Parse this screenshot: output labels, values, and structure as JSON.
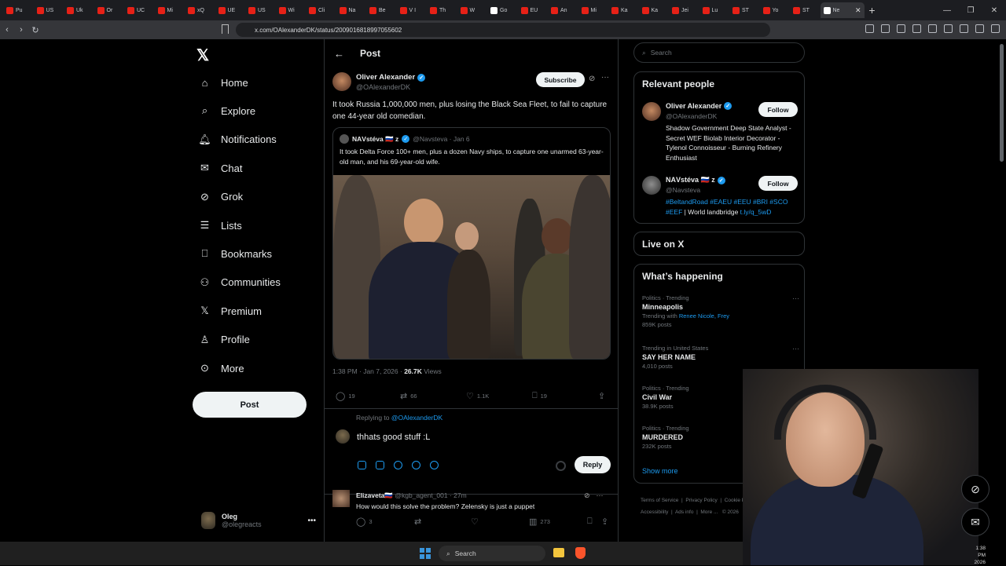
{
  "browser": {
    "tabs": [
      "Pu",
      "US",
      "Uk",
      "Or",
      "UC",
      "Mi",
      "xQ",
      "UE",
      "US",
      "Wi",
      "Cli",
      "Na",
      "Be",
      "V I",
      "Th",
      "W",
      "Go",
      "EU",
      "An",
      "Mi",
      "Ka",
      "Ka",
      "Jei",
      "Lu",
      "ST",
      "Yo",
      "ST",
      "Ne"
    ],
    "url": "x.com/OAlexanderDK/status/2009016818997055602",
    "new_tab": "+"
  },
  "nav": {
    "items": [
      {
        "label": "Home",
        "icon": "home-icon"
      },
      {
        "label": "Explore",
        "icon": "search-icon"
      },
      {
        "label": "Notifications",
        "icon": "bell-icon"
      },
      {
        "label": "Chat",
        "icon": "mail-icon"
      },
      {
        "label": "Grok",
        "icon": "grok-icon"
      },
      {
        "label": "Lists",
        "icon": "list-icon"
      },
      {
        "label": "Bookmarks",
        "icon": "bookmark-icon"
      },
      {
        "label": "Communities",
        "icon": "people-icon"
      },
      {
        "label": "Premium",
        "icon": "x-logo-icon"
      },
      {
        "label": "Profile",
        "icon": "person-icon"
      },
      {
        "label": "More",
        "icon": "more-circle-icon"
      }
    ],
    "post_label": "Post",
    "me": {
      "name": "Oleg",
      "handle": "@olegreacts"
    }
  },
  "header": {
    "title": "Post"
  },
  "tweet": {
    "author": "Oliver Alexander",
    "handle": "@OAlexanderDK",
    "subscribe_label": "Subscribe",
    "text": "It took Russia 1,000,000 men, plus losing the Black Sea Fleet, to fail to capture one 44-year old comedian.",
    "quote": {
      "author": "ΝΑVstéva 🇷🇺 z",
      "handle": "@Navsteva · Jan 6",
      "text": "It took Delta Force 100+ men, plus a dozen Navy ships, to capture one unarmed 63-year-old man, and his 69-year-old wife."
    },
    "time": "1:38 PM · Jan 7, 2026 · ",
    "views": "26.7K",
    "views_label": " Views",
    "stats": {
      "replies": "19",
      "reposts": "66",
      "likes": "1.1K",
      "bookmarks": "19"
    }
  },
  "compose": {
    "replying_prefix": "Replying to ",
    "replying_to": "@OAlexanderDK",
    "draft": "thhats good stuff :L",
    "reply_label": "Reply"
  },
  "reply": {
    "author": "Elizaveta🇷🇺",
    "handle": "@kgb_agent_001 · 27m",
    "text": "How would this solve the problem? Zelensky is just a puppet",
    "stats": {
      "replies": "3",
      "views": "273"
    }
  },
  "right": {
    "search_placeholder": "Search",
    "relevant_title": "Relevant people",
    "people": [
      {
        "name": "Oliver Alexander",
        "handle": "@OAlexanderDK",
        "bio": "Shadow Government Deep State Analyst - Secret WEF Biolab Interior Decorator - Tylenol Connoisseur - Burning Refinery Enthusiast",
        "follow": "Follow"
      },
      {
        "name": "ΝΑVstéva 🇷🇺 z",
        "handle": "@Navsteva",
        "bio_links": "#BeltandRoad #EAEU #EEU #BRI #SCO #EEF",
        "bio_text": " | World landbridge ",
        "bio_url": "t.ly/q_5wD",
        "follow": "Follow"
      }
    ],
    "live_title": "Live on X",
    "happening_title": "What’s happening",
    "trends": [
      {
        "cat": "Politics · Trending",
        "title": "Minneapolis",
        "sub_prefix": "Trending with ",
        "sub_links": "Renee Nicole, Frey",
        "count": "859K posts"
      },
      {
        "cat": "Trending in United States",
        "title": "SAY HER NAME",
        "count": "4,010 posts"
      },
      {
        "cat": "Politics · Trending",
        "title": "Civil War",
        "count": "38.9K posts"
      },
      {
        "cat": "Politics · Trending",
        "title": "MURDERED",
        "count": "232K posts"
      }
    ],
    "show_more": "Show more",
    "footer": [
      "Terms of Service",
      "Privacy Policy",
      "Cookie Policy",
      "Accessibility",
      "Ads info",
      "More ...",
      "© 2026"
    ]
  },
  "taskbar": {
    "search": "Search",
    "time": "1:38 PM",
    "date": "2026"
  }
}
